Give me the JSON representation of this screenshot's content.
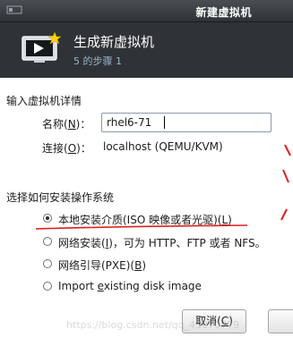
{
  "window": {
    "title": "新建虚拟机"
  },
  "header": {
    "title": "生成新虚拟机",
    "step": "5 的步骤 1"
  },
  "details": {
    "section_title": "输入虚拟机详情",
    "name_label_prefix": "名称(",
    "name_label_key": "N",
    "name_label_suffix": ")：",
    "name_value": "rhel6-71",
    "connection_label_prefix": "连接(",
    "connection_label_key": "O",
    "connection_label_suffix": ")：",
    "connection_value": "localhost (QEMU/KVM)"
  },
  "install": {
    "section_title": "选择如何安装操作系统",
    "options": [
      {
        "prefix": "本地安装介质(ISO 映像或者光驱)(",
        "key": "L",
        "suffix": ")",
        "selected": true
      },
      {
        "prefix": "网络安装(",
        "key": "I",
        "suffix": ")，可为 HTTP、FTP 或者 NFS。",
        "selected": false
      },
      {
        "prefix": "网络引导(PXE)(",
        "key": "B",
        "suffix": ")",
        "selected": false
      },
      {
        "prefix": "Import ",
        "key": "e",
        "suffix": "xisting disk image",
        "selected": false
      }
    ]
  },
  "buttons": {
    "cancel_prefix": "取消(",
    "cancel_key": "C",
    "cancel_suffix": ")"
  },
  "watermark": "https://blog.csdn.net/qq_43070779",
  "colors": {
    "titlebar": "#3a3d41",
    "header_bg": "#2f3236",
    "header_title": "#ffffff",
    "header_step": "#9ab3c9",
    "annotation_red": "#e02020"
  },
  "icons": {
    "window_app": "window-app-icon",
    "wizard": "new-vm-monitor-star-icon"
  }
}
